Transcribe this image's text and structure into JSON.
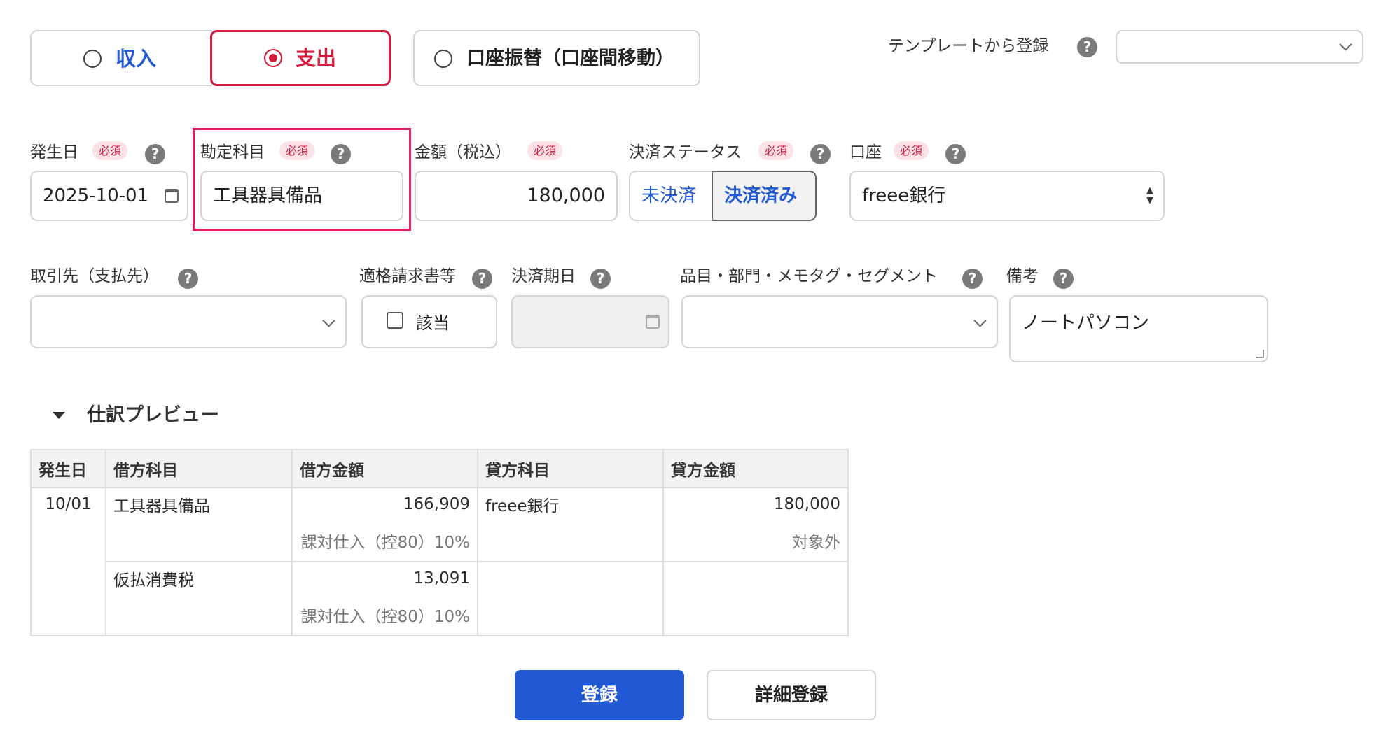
{
  "type_tabs": {
    "income": "収入",
    "expense": "支出",
    "transfer": "口座振替（口座間移動）"
  },
  "template": {
    "label": "テンプレートから登録",
    "value": ""
  },
  "required_badge": "必須",
  "fields": {
    "date": {
      "label": "発生日",
      "value": "2025-10-01"
    },
    "account_item": {
      "label": "勘定科目",
      "value": "工具器具備品"
    },
    "amount": {
      "label": "金額（税込）",
      "value": "180,000"
    },
    "settlement_status": {
      "label": "決済ステータス",
      "unsettled": "未決済",
      "settled": "決済済み",
      "selected": "決済済み"
    },
    "wallet": {
      "label": "口座",
      "value": "freee銀行"
    },
    "partner": {
      "label": "取引先（支払先）",
      "value": ""
    },
    "invoice": {
      "label": "適格請求書等",
      "checkbox_label": "該当",
      "checked": false
    },
    "due_date": {
      "label": "決済期日",
      "value": ""
    },
    "tags": {
      "label": "品目・部門・メモタグ・セグメント",
      "value": ""
    },
    "memo": {
      "label": "備考",
      "value": "ノートパソコン"
    }
  },
  "preview": {
    "title": "仕訳プレビュー",
    "headers": [
      "発生日",
      "借方科目",
      "借方金額",
      "貸方科目",
      "貸方金額"
    ],
    "date": "10/01",
    "rows": [
      {
        "debit_item": "工具器具備品",
        "debit_amount": "166,909",
        "debit_tax": "課対仕入（控80）10%",
        "credit_item": "freee銀行",
        "credit_amount": "180,000",
        "credit_tax": "対象外"
      },
      {
        "debit_item": "仮払消費税",
        "debit_amount": "13,091",
        "debit_tax": "課対仕入（控80）10%",
        "credit_item": "",
        "credit_amount": "",
        "credit_tax": ""
      }
    ]
  },
  "buttons": {
    "register": "登録",
    "detail_register": "詳細登録"
  },
  "colors": {
    "accent_blue": "#2159d4",
    "active_red": "#d41b3b",
    "highlight_pink": "#e8195c"
  }
}
